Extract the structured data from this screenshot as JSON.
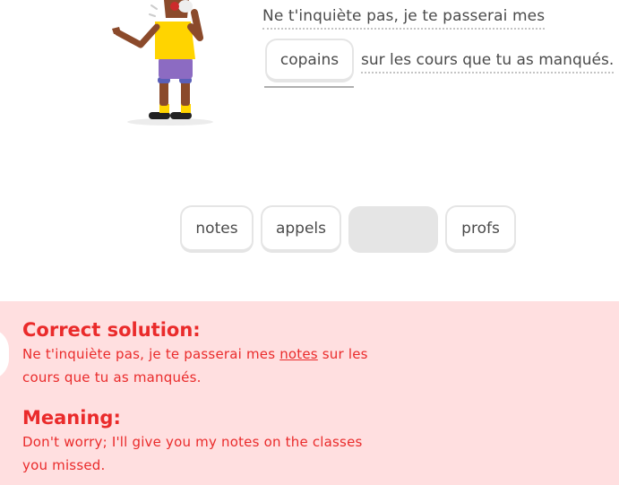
{
  "exercise": {
    "sentence_before": "Ne t'inquiète pas, je te passerai mes",
    "selected_answer": "copains",
    "sentence_after": "sur les cours que tu as manqués."
  },
  "word_bank": [
    {
      "label": "notes"
    },
    {
      "label": "appels"
    },
    {
      "label": ""
    },
    {
      "label": "profs"
    }
  ],
  "feedback": {
    "solution_heading": "Correct solution:",
    "solution_before": "Ne t'inquiète pas, je te passerai mes",
    "solution_answer": "notes",
    "solution_after": "sur les cours que tu as manqués.",
    "meaning_heading": "Meaning:",
    "meaning_text": "Don't worry; I'll give you my notes on the classes you missed."
  },
  "colors": {
    "error_red": "#ea2b2b",
    "feedback_background": "#ffdfe0",
    "chip_border": "#e5e5e5",
    "text_gray": "#4b4b4b"
  }
}
